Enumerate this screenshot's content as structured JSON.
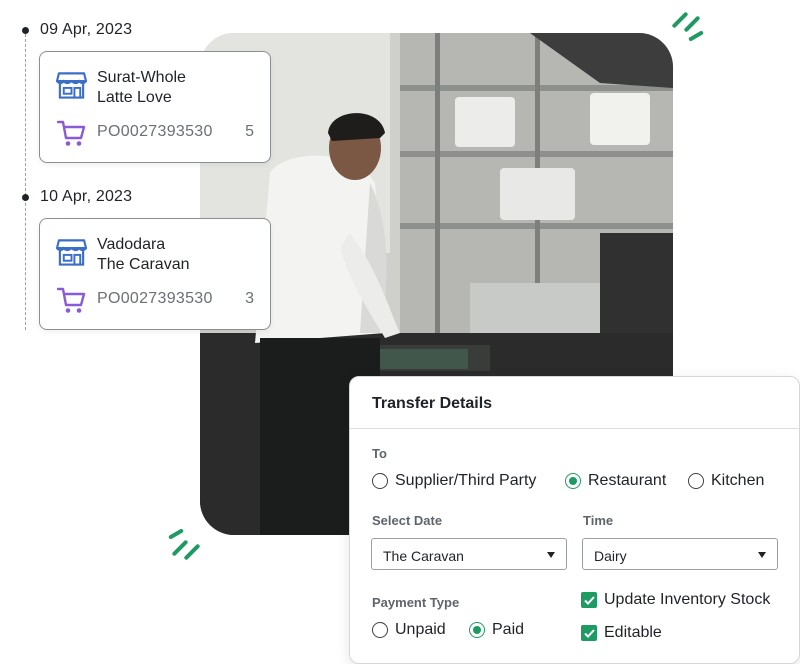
{
  "timeline": [
    {
      "date": "09 Apr, 2023",
      "store_icon": "store-icon",
      "cart_icon": "cart-icon",
      "name_line1": "Surat-Whole",
      "name_line2": "Latte Love",
      "po_number": "PO0027393530",
      "quantity": "5"
    },
    {
      "date": "10 Apr, 2023",
      "store_icon": "store-icon",
      "cart_icon": "cart-icon",
      "name_line1": "Vadodara",
      "name_line2": "The Caravan",
      "po_number": "PO0027393530",
      "quantity": "3"
    }
  ],
  "transfer": {
    "title": "Transfer Details",
    "to_label": "To",
    "to_options": [
      {
        "label": "Supplier/Third Party",
        "selected": false
      },
      {
        "label": "Restaurant",
        "selected": true
      },
      {
        "label": "Kitchen",
        "selected": false
      }
    ],
    "select_date_label": "Select Date",
    "select_date_value": "The Caravan",
    "time_label": "Time",
    "time_value": "Dairy",
    "payment_type_label": "Payment Type",
    "payment_options": [
      {
        "label": "Unpaid",
        "selected": false
      },
      {
        "label": "Paid",
        "selected": true
      }
    ],
    "checkboxes": [
      {
        "label": "Update Inventory Stock",
        "checked": true
      },
      {
        "label": "Editable",
        "checked": true
      }
    ]
  },
  "colors": {
    "accent_green": "#1e9b63",
    "store_icon_blue": "#3b6fc7",
    "cart_icon_purple": "#8a5bd6"
  }
}
